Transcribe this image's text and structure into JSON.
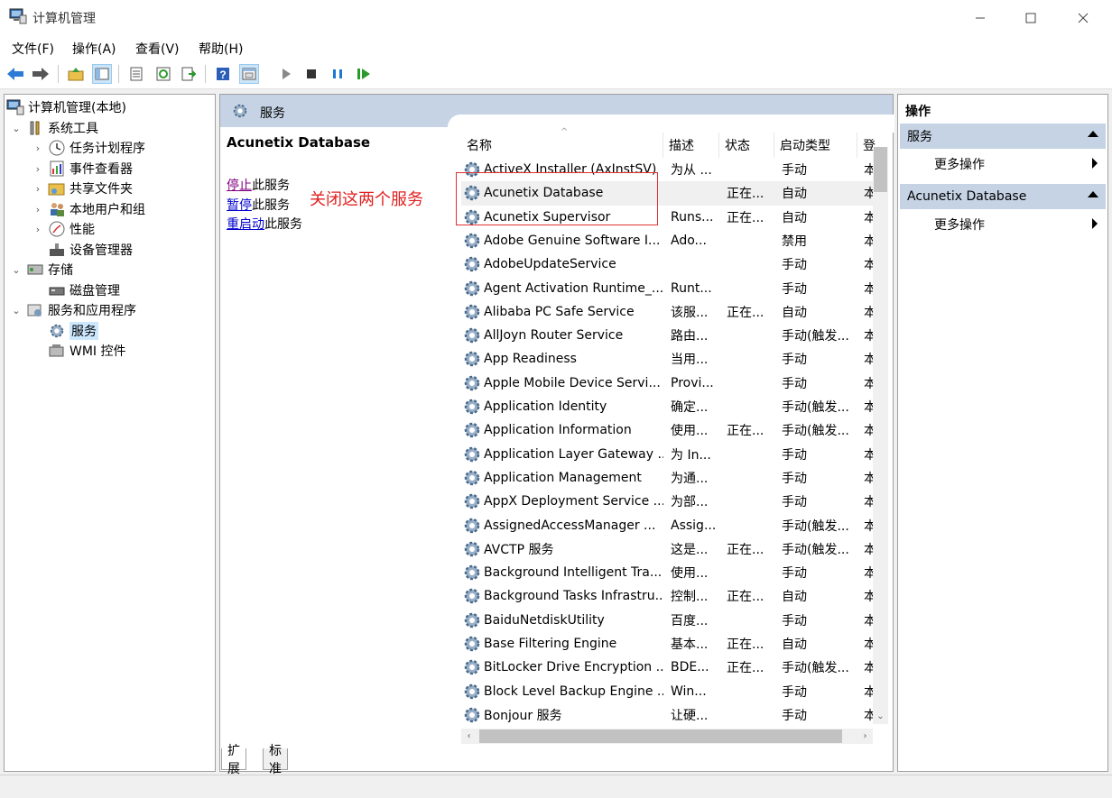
{
  "window": {
    "title": "计算机管理"
  },
  "menu": [
    "文件(F)",
    "操作(A)",
    "查看(V)",
    "帮助(H)"
  ],
  "tree": {
    "root": "计算机管理(本地)",
    "system_tools": "系统工具",
    "task_scheduler": "任务计划程序",
    "event_viewer": "事件查看器",
    "shared_folders": "共享文件夹",
    "local_users": "本地用户和组",
    "performance": "性能",
    "device_manager": "设备管理器",
    "storage": "存储",
    "disk_management": "磁盘管理",
    "services_apps": "服务和应用程序",
    "services": "服务",
    "wmi": "WMI 控件"
  },
  "center": {
    "header": "服务",
    "selected_title": "Acunetix Database",
    "stop": "停止",
    "stop_suffix": "此服务",
    "pause": "暂停",
    "pause_suffix": "此服务",
    "restart": "重启动",
    "restart_suffix": "此服务",
    "annotation": "关闭这两个服务",
    "columns": [
      "名称",
      "描述",
      "状态",
      "启动类型",
      "登"
    ],
    "tabs": [
      "扩展",
      "标准"
    ]
  },
  "services": [
    {
      "name": "ActiveX Installer (AxInstSV)",
      "desc": "为从 ...",
      "status": "",
      "start": "手动",
      "log": "本"
    },
    {
      "name": "Acunetix Database",
      "desc": "",
      "status": "正在...",
      "start": "自动",
      "log": "本"
    },
    {
      "name": "Acunetix Supervisor",
      "desc": "Runs...",
      "status": "正在...",
      "start": "自动",
      "log": "本"
    },
    {
      "name": "Adobe Genuine Software I...",
      "desc": "Ado...",
      "status": "",
      "start": "禁用",
      "log": "本"
    },
    {
      "name": "AdobeUpdateService",
      "desc": "",
      "status": "",
      "start": "手动",
      "log": "本"
    },
    {
      "name": "Agent Activation Runtime_...",
      "desc": "Runt...",
      "status": "",
      "start": "手动",
      "log": "本"
    },
    {
      "name": "Alibaba PC Safe Service",
      "desc": "该服...",
      "status": "正在...",
      "start": "自动",
      "log": "本"
    },
    {
      "name": "AllJoyn Router Service",
      "desc": "路由...",
      "status": "",
      "start": "手动(触发...",
      "log": "本"
    },
    {
      "name": "App Readiness",
      "desc": "当用...",
      "status": "",
      "start": "手动",
      "log": "本"
    },
    {
      "name": "Apple Mobile Device Servi...",
      "desc": "Provi...",
      "status": "",
      "start": "手动",
      "log": "本"
    },
    {
      "name": "Application Identity",
      "desc": "确定...",
      "status": "",
      "start": "手动(触发...",
      "log": "本"
    },
    {
      "name": "Application Information",
      "desc": "使用...",
      "status": "正在...",
      "start": "手动(触发...",
      "log": "本"
    },
    {
      "name": "Application Layer Gateway ...",
      "desc": "为 In...",
      "status": "",
      "start": "手动",
      "log": "本"
    },
    {
      "name": "Application Management",
      "desc": "为通...",
      "status": "",
      "start": "手动",
      "log": "本"
    },
    {
      "name": "AppX Deployment Service ...",
      "desc": "为部...",
      "status": "",
      "start": "手动",
      "log": "本"
    },
    {
      "name": "AssignedAccessManager ...",
      "desc": "Assig...",
      "status": "",
      "start": "手动(触发...",
      "log": "本"
    },
    {
      "name": "AVCTP 服务",
      "desc": "这是...",
      "status": "正在...",
      "start": "手动(触发...",
      "log": "本"
    },
    {
      "name": "Background Intelligent Tra...",
      "desc": "使用...",
      "status": "",
      "start": "手动",
      "log": "本"
    },
    {
      "name": "Background Tasks Infrastru...",
      "desc": "控制...",
      "status": "正在...",
      "start": "自动",
      "log": "本"
    },
    {
      "name": "BaiduNetdiskUtility",
      "desc": "百度...",
      "status": "",
      "start": "手动",
      "log": "本"
    },
    {
      "name": "Base Filtering Engine",
      "desc": "基本...",
      "status": "正在...",
      "start": "自动",
      "log": "本"
    },
    {
      "name": "BitLocker Drive Encryption ...",
      "desc": "BDE...",
      "status": "正在...",
      "start": "手动(触发...",
      "log": "本"
    },
    {
      "name": "Block Level Backup Engine ...",
      "desc": "Win...",
      "status": "",
      "start": "手动",
      "log": "本"
    },
    {
      "name": "Bonjour 服务",
      "desc": "让硬...",
      "status": "",
      "start": "手动",
      "log": "本"
    }
  ],
  "actions": {
    "title": "操作",
    "section1": "服务",
    "section1_item": "更多操作",
    "section2": "Acunetix Database",
    "section2_item": "更多操作"
  }
}
